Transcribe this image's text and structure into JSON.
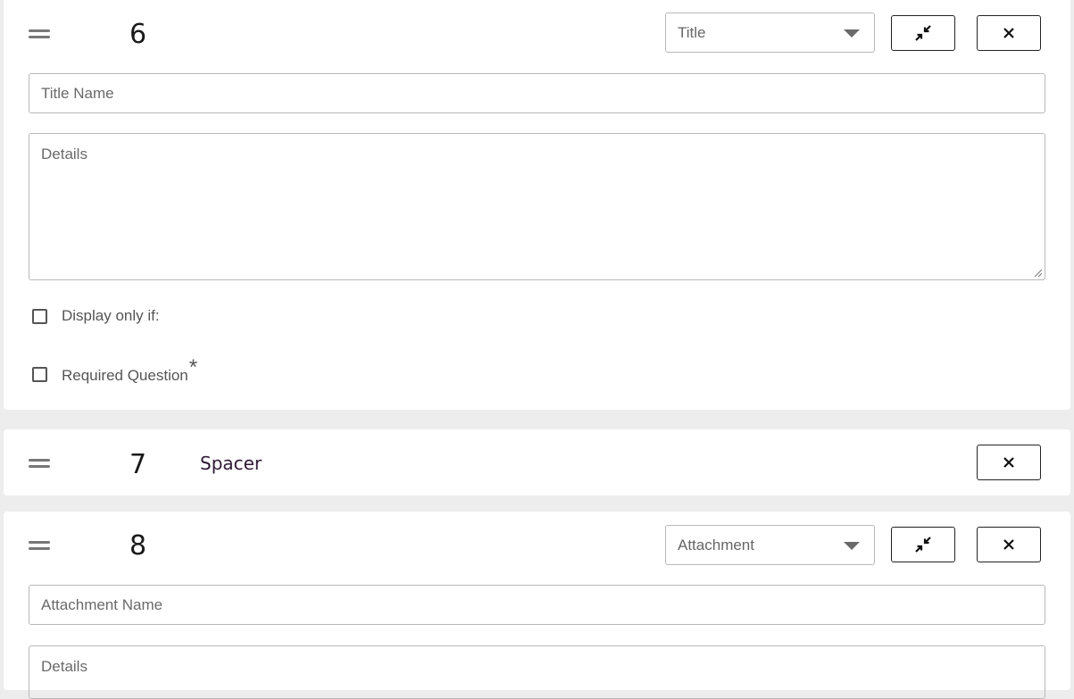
{
  "questions": [
    {
      "number": "6",
      "type_selected": "Title",
      "name_placeholder": "Title Name",
      "details_placeholder": "Details",
      "display_only_if_label": "Display only if:",
      "required_label": "Required Question",
      "required_marker": "*"
    },
    {
      "number": "7",
      "type_label": "Spacer"
    },
    {
      "number": "8",
      "type_selected": "Attachment",
      "name_placeholder": "Attachment Name",
      "details_placeholder": "Details"
    }
  ],
  "icons": {
    "drag": "drag-handle-icon",
    "collapse": "collapse-icon",
    "close": "close-icon",
    "dropdown": "caret-down-icon"
  },
  "colors": {
    "page_background": "#ededed",
    "card_background": "#ffffff",
    "field_border": "#b8b8b8",
    "button_border": "#222222",
    "spacer_label": "#2e1a33"
  }
}
